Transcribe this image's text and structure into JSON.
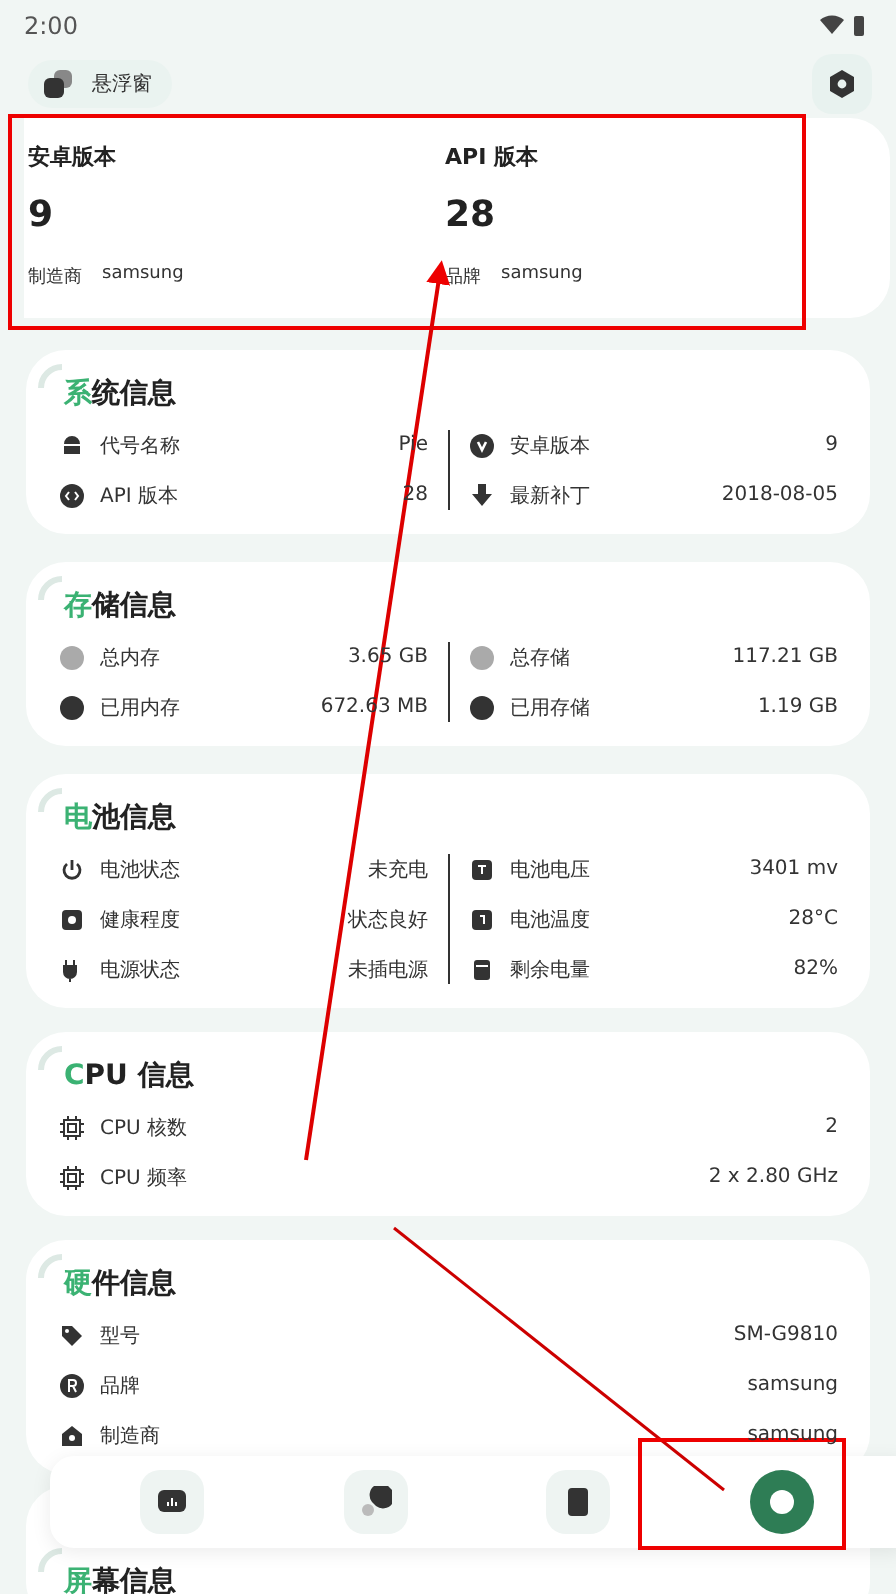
{
  "status_bar": {
    "time": "2:00"
  },
  "float_chip": {
    "label": "悬浮窗"
  },
  "hero": [
    {
      "label": "安卓版本",
      "value": "9",
      "sub_label": "制造商",
      "sub_value": "samsung"
    },
    {
      "label": "API 版本",
      "value": "28",
      "sub_label": "品牌",
      "sub_value": "samsung"
    }
  ],
  "sections": [
    {
      "kind": "split",
      "accent": "系",
      "title": "统信息",
      "left": [
        {
          "label": "代号名称",
          "value": "Pie"
        },
        {
          "label": "API 版本",
          "value": "28"
        }
      ],
      "right": [
        {
          "label": "安卓版本",
          "value": "9"
        },
        {
          "label": "最新补丁",
          "value": "2018-08-05"
        }
      ]
    },
    {
      "kind": "split",
      "accent": "存",
      "title": "储信息",
      "left": [
        {
          "label": "总内存",
          "value": "3.65 GB"
        },
        {
          "label": "已用内存",
          "value": "672.63 MB"
        }
      ],
      "right": [
        {
          "label": "总存储",
          "value": "117.21 GB"
        },
        {
          "label": "已用存储",
          "value": "1.19 GB"
        }
      ]
    },
    {
      "kind": "split",
      "accent": "电",
      "title": "池信息",
      "left": [
        {
          "label": "电池状态",
          "value": "未充电"
        },
        {
          "label": "健康程度",
          "value": "状态良好"
        },
        {
          "label": "电源状态",
          "value": "未插电源"
        }
      ],
      "right": [
        {
          "label": "电池电压",
          "value": "3401 mv"
        },
        {
          "label": "电池温度",
          "value": "28°C"
        },
        {
          "label": "剩余电量",
          "value": "82%"
        }
      ]
    },
    {
      "kind": "list",
      "accent": "C",
      "title": "PU 信息",
      "items": [
        {
          "label": "CPU 核数",
          "value": "2"
        },
        {
          "label": "CPU 频率",
          "value": "2 x 2.80 GHz"
        }
      ]
    },
    {
      "kind": "list",
      "accent": "硬",
      "title": "件信息",
      "items": [
        {
          "label": "型号",
          "value": "SM-G9810"
        },
        {
          "label": "品牌",
          "value": "samsung"
        },
        {
          "label": "制造商",
          "value": "samsung"
        }
      ]
    },
    {
      "kind": "list",
      "accent": "屏",
      "title": "幕信息"
    }
  ],
  "nav": [
    {
      "selected": false
    },
    {
      "selected": false
    },
    {
      "selected": false
    },
    {
      "selected": true
    }
  ]
}
